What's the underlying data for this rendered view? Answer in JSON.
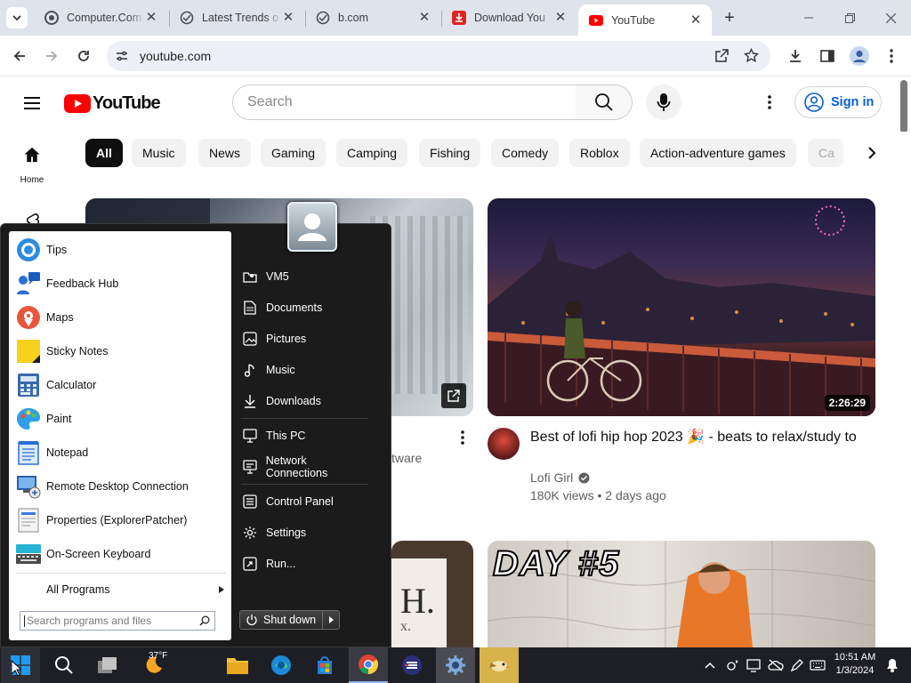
{
  "browser": {
    "tabs": [
      {
        "title": "Computer.Com",
        "icon": "chrome-favicon"
      },
      {
        "title": "Latest Trends o",
        "icon": "globe-favicon"
      },
      {
        "title": "b.com",
        "icon": "globe-favicon"
      },
      {
        "title": "Download You",
        "icon": "download-favicon"
      },
      {
        "title": "YouTube",
        "icon": "youtube-favicon",
        "active": true
      }
    ],
    "url": "youtube.com",
    "accent": "#dfe3eb"
  },
  "youtube": {
    "logo_text": "YouTube",
    "search_placeholder": "Search",
    "sign_in": "Sign in",
    "sidebar_home": "Home",
    "chips": [
      "All",
      "Music",
      "News",
      "Gaming",
      "Camping",
      "Fishing",
      "Comedy",
      "Roblox",
      "Action-adventure games",
      "Ca"
    ],
    "left_video_partial_text": "tware",
    "video1": {
      "title": "Best of lofi hip hop 2023 🎉 - beats to relax/study to",
      "channel": "Lofi Girl",
      "meta": "180K views • 2 days ago",
      "duration": "2:26:29"
    },
    "video2": {
      "thumb_text": "DAY #5"
    },
    "left_bottom_thumb_text": "H.",
    "left_bottom_thumb_subtext": "x."
  },
  "start_menu": {
    "programs": [
      {
        "label": "Tips",
        "icon": "tips-icon"
      },
      {
        "label": "Feedback Hub",
        "icon": "feedback-hub-icon"
      },
      {
        "label": "Maps",
        "icon": "maps-icon"
      },
      {
        "label": "Sticky Notes",
        "icon": "sticky-notes-icon"
      },
      {
        "label": "Calculator",
        "icon": "calculator-icon"
      },
      {
        "label": "Paint",
        "icon": "paint-icon"
      },
      {
        "label": "Notepad",
        "icon": "notepad-icon"
      },
      {
        "label": "Remote Desktop Connection",
        "icon": "remote-desktop-icon"
      },
      {
        "label": "Properties (ExplorerPatcher)",
        "icon": "properties-icon"
      },
      {
        "label": "On-Screen Keyboard",
        "icon": "keyboard-icon"
      }
    ],
    "all_programs": "All Programs",
    "search_placeholder": "Search programs and files",
    "places": [
      {
        "label": "VM5",
        "icon": "folder-icon"
      },
      {
        "label": "Documents",
        "icon": "document-icon"
      },
      {
        "label": "Pictures",
        "icon": "pictures-icon"
      },
      {
        "label": "Music",
        "icon": "music-icon"
      },
      {
        "label": "Downloads",
        "icon": "download-icon"
      },
      {
        "label": "This PC",
        "icon": "computer-icon"
      },
      {
        "label": "Network Connections",
        "icon": "network-icon"
      },
      {
        "label": "Control Panel",
        "icon": "control-panel-icon"
      },
      {
        "label": "Settings",
        "icon": "gear-icon"
      },
      {
        "label": "Run...",
        "icon": "run-icon"
      }
    ],
    "shutdown": "Shut down"
  },
  "taskbar": {
    "weather": "37°F",
    "time": "10:51 AM",
    "date": "1/3/2024"
  }
}
